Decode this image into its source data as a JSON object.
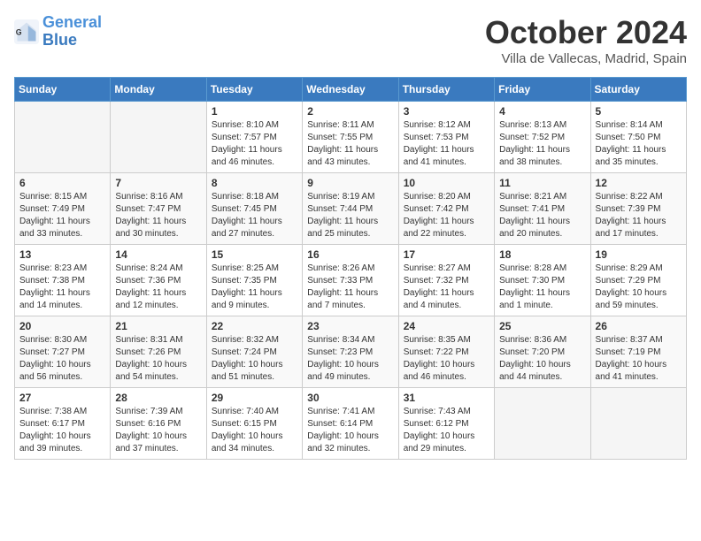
{
  "header": {
    "logo_general": "General",
    "logo_blue": "Blue",
    "month": "October 2024",
    "location": "Villa de Vallecas, Madrid, Spain"
  },
  "weekdays": [
    "Sunday",
    "Monday",
    "Tuesday",
    "Wednesday",
    "Thursday",
    "Friday",
    "Saturday"
  ],
  "weeks": [
    [
      {
        "day": "",
        "empty": true
      },
      {
        "day": "",
        "empty": true
      },
      {
        "day": "1",
        "sunrise": "Sunrise: 8:10 AM",
        "sunset": "Sunset: 7:57 PM",
        "daylight": "Daylight: 11 hours and 46 minutes."
      },
      {
        "day": "2",
        "sunrise": "Sunrise: 8:11 AM",
        "sunset": "Sunset: 7:55 PM",
        "daylight": "Daylight: 11 hours and 43 minutes."
      },
      {
        "day": "3",
        "sunrise": "Sunrise: 8:12 AM",
        "sunset": "Sunset: 7:53 PM",
        "daylight": "Daylight: 11 hours and 41 minutes."
      },
      {
        "day": "4",
        "sunrise": "Sunrise: 8:13 AM",
        "sunset": "Sunset: 7:52 PM",
        "daylight": "Daylight: 11 hours and 38 minutes."
      },
      {
        "day": "5",
        "sunrise": "Sunrise: 8:14 AM",
        "sunset": "Sunset: 7:50 PM",
        "daylight": "Daylight: 11 hours and 35 minutes."
      }
    ],
    [
      {
        "day": "6",
        "sunrise": "Sunrise: 8:15 AM",
        "sunset": "Sunset: 7:49 PM",
        "daylight": "Daylight: 11 hours and 33 minutes."
      },
      {
        "day": "7",
        "sunrise": "Sunrise: 8:16 AM",
        "sunset": "Sunset: 7:47 PM",
        "daylight": "Daylight: 11 hours and 30 minutes."
      },
      {
        "day": "8",
        "sunrise": "Sunrise: 8:18 AM",
        "sunset": "Sunset: 7:45 PM",
        "daylight": "Daylight: 11 hours and 27 minutes."
      },
      {
        "day": "9",
        "sunrise": "Sunrise: 8:19 AM",
        "sunset": "Sunset: 7:44 PM",
        "daylight": "Daylight: 11 hours and 25 minutes."
      },
      {
        "day": "10",
        "sunrise": "Sunrise: 8:20 AM",
        "sunset": "Sunset: 7:42 PM",
        "daylight": "Daylight: 11 hours and 22 minutes."
      },
      {
        "day": "11",
        "sunrise": "Sunrise: 8:21 AM",
        "sunset": "Sunset: 7:41 PM",
        "daylight": "Daylight: 11 hours and 20 minutes."
      },
      {
        "day": "12",
        "sunrise": "Sunrise: 8:22 AM",
        "sunset": "Sunset: 7:39 PM",
        "daylight": "Daylight: 11 hours and 17 minutes."
      }
    ],
    [
      {
        "day": "13",
        "sunrise": "Sunrise: 8:23 AM",
        "sunset": "Sunset: 7:38 PM",
        "daylight": "Daylight: 11 hours and 14 minutes."
      },
      {
        "day": "14",
        "sunrise": "Sunrise: 8:24 AM",
        "sunset": "Sunset: 7:36 PM",
        "daylight": "Daylight: 11 hours and 12 minutes."
      },
      {
        "day": "15",
        "sunrise": "Sunrise: 8:25 AM",
        "sunset": "Sunset: 7:35 PM",
        "daylight": "Daylight: 11 hours and 9 minutes."
      },
      {
        "day": "16",
        "sunrise": "Sunrise: 8:26 AM",
        "sunset": "Sunset: 7:33 PM",
        "daylight": "Daylight: 11 hours and 7 minutes."
      },
      {
        "day": "17",
        "sunrise": "Sunrise: 8:27 AM",
        "sunset": "Sunset: 7:32 PM",
        "daylight": "Daylight: 11 hours and 4 minutes."
      },
      {
        "day": "18",
        "sunrise": "Sunrise: 8:28 AM",
        "sunset": "Sunset: 7:30 PM",
        "daylight": "Daylight: 11 hours and 1 minute."
      },
      {
        "day": "19",
        "sunrise": "Sunrise: 8:29 AM",
        "sunset": "Sunset: 7:29 PM",
        "daylight": "Daylight: 10 hours and 59 minutes."
      }
    ],
    [
      {
        "day": "20",
        "sunrise": "Sunrise: 8:30 AM",
        "sunset": "Sunset: 7:27 PM",
        "daylight": "Daylight: 10 hours and 56 minutes."
      },
      {
        "day": "21",
        "sunrise": "Sunrise: 8:31 AM",
        "sunset": "Sunset: 7:26 PM",
        "daylight": "Daylight: 10 hours and 54 minutes."
      },
      {
        "day": "22",
        "sunrise": "Sunrise: 8:32 AM",
        "sunset": "Sunset: 7:24 PM",
        "daylight": "Daylight: 10 hours and 51 minutes."
      },
      {
        "day": "23",
        "sunrise": "Sunrise: 8:34 AM",
        "sunset": "Sunset: 7:23 PM",
        "daylight": "Daylight: 10 hours and 49 minutes."
      },
      {
        "day": "24",
        "sunrise": "Sunrise: 8:35 AM",
        "sunset": "Sunset: 7:22 PM",
        "daylight": "Daylight: 10 hours and 46 minutes."
      },
      {
        "day": "25",
        "sunrise": "Sunrise: 8:36 AM",
        "sunset": "Sunset: 7:20 PM",
        "daylight": "Daylight: 10 hours and 44 minutes."
      },
      {
        "day": "26",
        "sunrise": "Sunrise: 8:37 AM",
        "sunset": "Sunset: 7:19 PM",
        "daylight": "Daylight: 10 hours and 41 minutes."
      }
    ],
    [
      {
        "day": "27",
        "sunrise": "Sunrise: 7:38 AM",
        "sunset": "Sunset: 6:17 PM",
        "daylight": "Daylight: 10 hours and 39 minutes."
      },
      {
        "day": "28",
        "sunrise": "Sunrise: 7:39 AM",
        "sunset": "Sunset: 6:16 PM",
        "daylight": "Daylight: 10 hours and 37 minutes."
      },
      {
        "day": "29",
        "sunrise": "Sunrise: 7:40 AM",
        "sunset": "Sunset: 6:15 PM",
        "daylight": "Daylight: 10 hours and 34 minutes."
      },
      {
        "day": "30",
        "sunrise": "Sunrise: 7:41 AM",
        "sunset": "Sunset: 6:14 PM",
        "daylight": "Daylight: 10 hours and 32 minutes."
      },
      {
        "day": "31",
        "sunrise": "Sunrise: 7:43 AM",
        "sunset": "Sunset: 6:12 PM",
        "daylight": "Daylight: 10 hours and 29 minutes."
      },
      {
        "day": "",
        "empty": true
      },
      {
        "day": "",
        "empty": true
      }
    ]
  ]
}
